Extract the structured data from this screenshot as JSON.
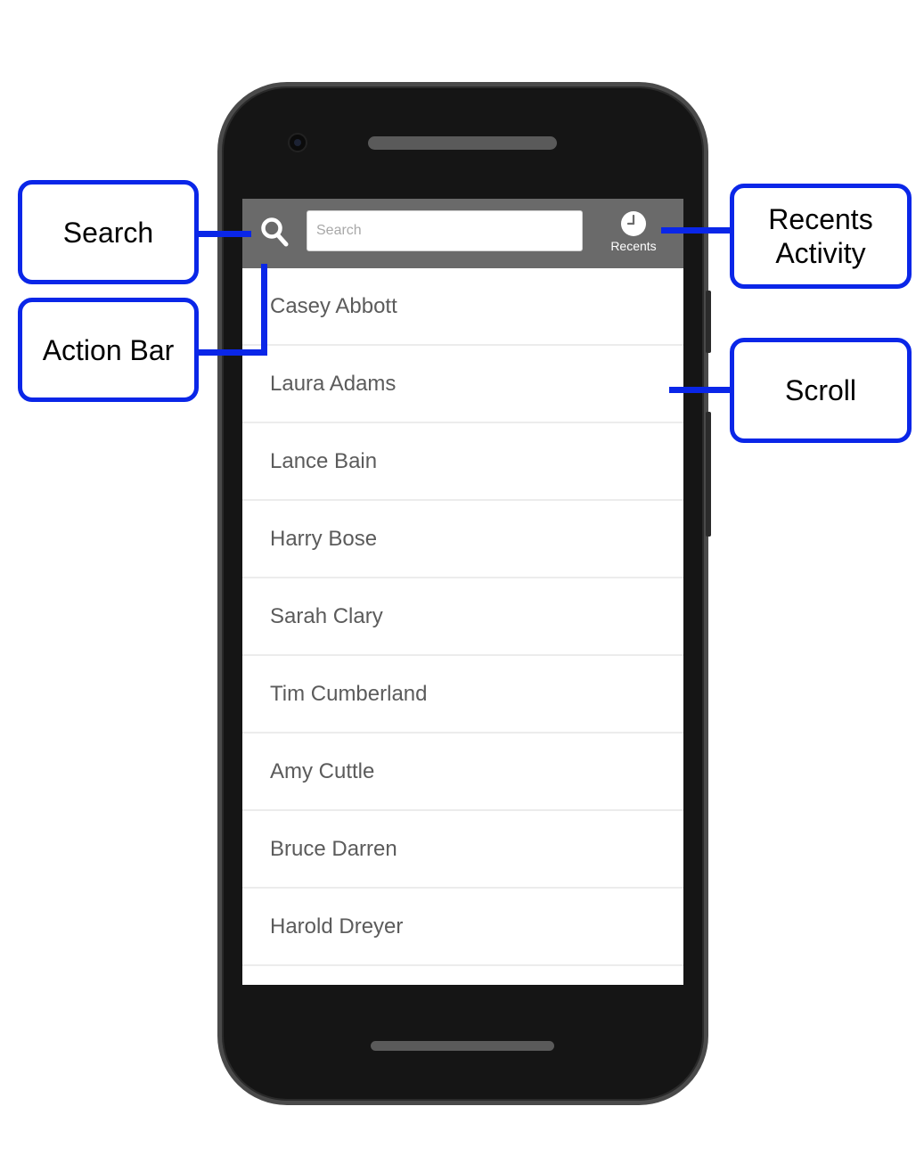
{
  "app": {
    "search": {
      "placeholder": "Search",
      "value": ""
    },
    "recents_label": "Recents",
    "contacts": [
      "Casey Abbott",
      "Laura Adams",
      "Lance Bain",
      "Harry Bose",
      "Sarah Clary",
      "Tim Cumberland",
      "Amy Cuttle",
      "Bruce Darren",
      "Harold Dreyer"
    ]
  },
  "callouts": {
    "search": "Search",
    "action_bar": "Action Bar",
    "recents_activity": "Recents Activity",
    "scroll": "Scroll"
  },
  "colors": {
    "callout_border": "#0a26e8",
    "action_bar": "#6a6a6a",
    "list_text": "#5b5b5b",
    "phone_body": "#151515"
  },
  "icons": [
    "search-icon",
    "clock-icon"
  ]
}
